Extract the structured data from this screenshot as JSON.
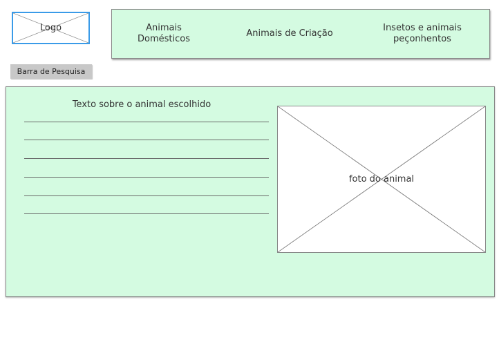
{
  "header": {
    "logo_label": "Logo"
  },
  "nav": {
    "items": [
      {
        "label": "Animais\nDomésticos"
      },
      {
        "label": "Animais de Criação"
      },
      {
        "label": "Insetos e  animais\npeçonhentos"
      }
    ]
  },
  "search": {
    "label": "Barra de Pesquisa"
  },
  "content": {
    "text_title": "Texto sobre o animal escolhido",
    "photo_label": "foto do animal"
  },
  "colors": {
    "panel_background": "#d4fbe1",
    "logo_border": "#3a9be8",
    "search_background": "#c8c8c8"
  },
  "icons": {
    "placeholder": "image-placeholder-icon"
  }
}
